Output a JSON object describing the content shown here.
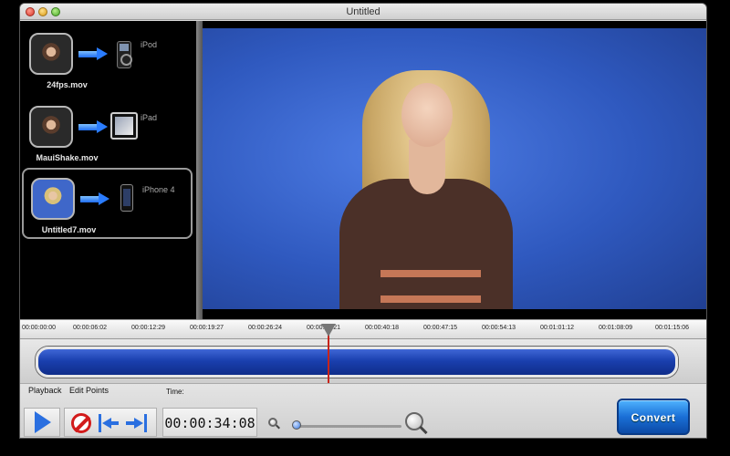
{
  "window": {
    "title": "Untitled"
  },
  "sidebar": {
    "items": [
      {
        "file": "24fps.mov",
        "device": "iPod",
        "device_icon": "ipod-icon",
        "selected": false
      },
      {
        "file": "MauiShake.mov",
        "device": "iPad",
        "device_icon": "ipad-icon",
        "selected": false
      },
      {
        "file": "Untitled7.mov",
        "device": "iPhone 4",
        "device_icon": "iphone-icon",
        "selected": true
      }
    ]
  },
  "timeline": {
    "ticks": [
      "00:00:00:00",
      "00:00:06:02",
      "00:00:12:29",
      "00:00:19:27",
      "00:00:26:24",
      "00:00:33:21",
      "00:00:40:18",
      "00:00:47:15",
      "00:00:54:13",
      "00:01:01:12",
      "00:01:08:09",
      "00:01:15:06"
    ],
    "clip_color": "#1a3fae",
    "playhead_color": "#c8241a"
  },
  "controls": {
    "playback_label": "Playback",
    "edit_points_label": "Edit Points",
    "time_label": "Time:",
    "time_value": "00:00:34:08",
    "convert_label": "Convert"
  }
}
